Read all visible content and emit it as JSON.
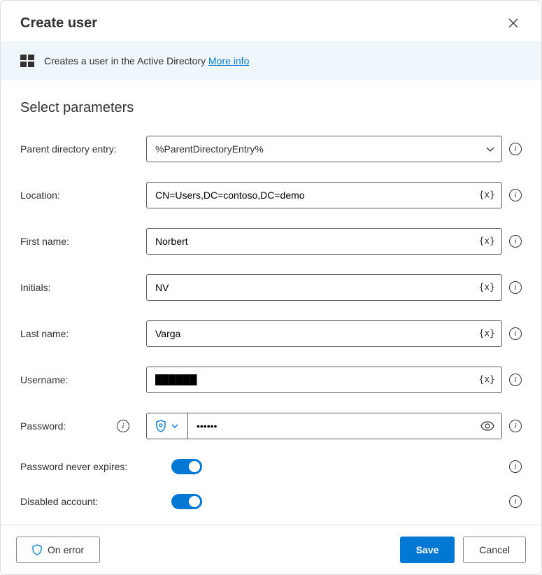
{
  "title": "Create user",
  "bannerText": "Creates a user in the Active Directory ",
  "bannerLink": "More info",
  "sectionTitle": "Select parameters",
  "labels": {
    "parent": "Parent directory entry:",
    "location": "Location:",
    "first": "First name:",
    "initials": "Initials:",
    "last": "Last name:",
    "username": "Username:",
    "password": "Password:",
    "neverExpires": "Password never expires:",
    "disabled": "Disabled account:"
  },
  "values": {
    "parent": "%ParentDirectoryEntry%",
    "location": "CN=Users,DC=contoso,DC=demo",
    "first": "Norbert",
    "initials": "NV",
    "last": "Varga",
    "username": "██████",
    "password": "██████",
    "neverExpires": true,
    "disabled": true
  },
  "varBadge": "{x}",
  "footer": {
    "onError": "On error",
    "save": "Save",
    "cancel": "Cancel"
  }
}
